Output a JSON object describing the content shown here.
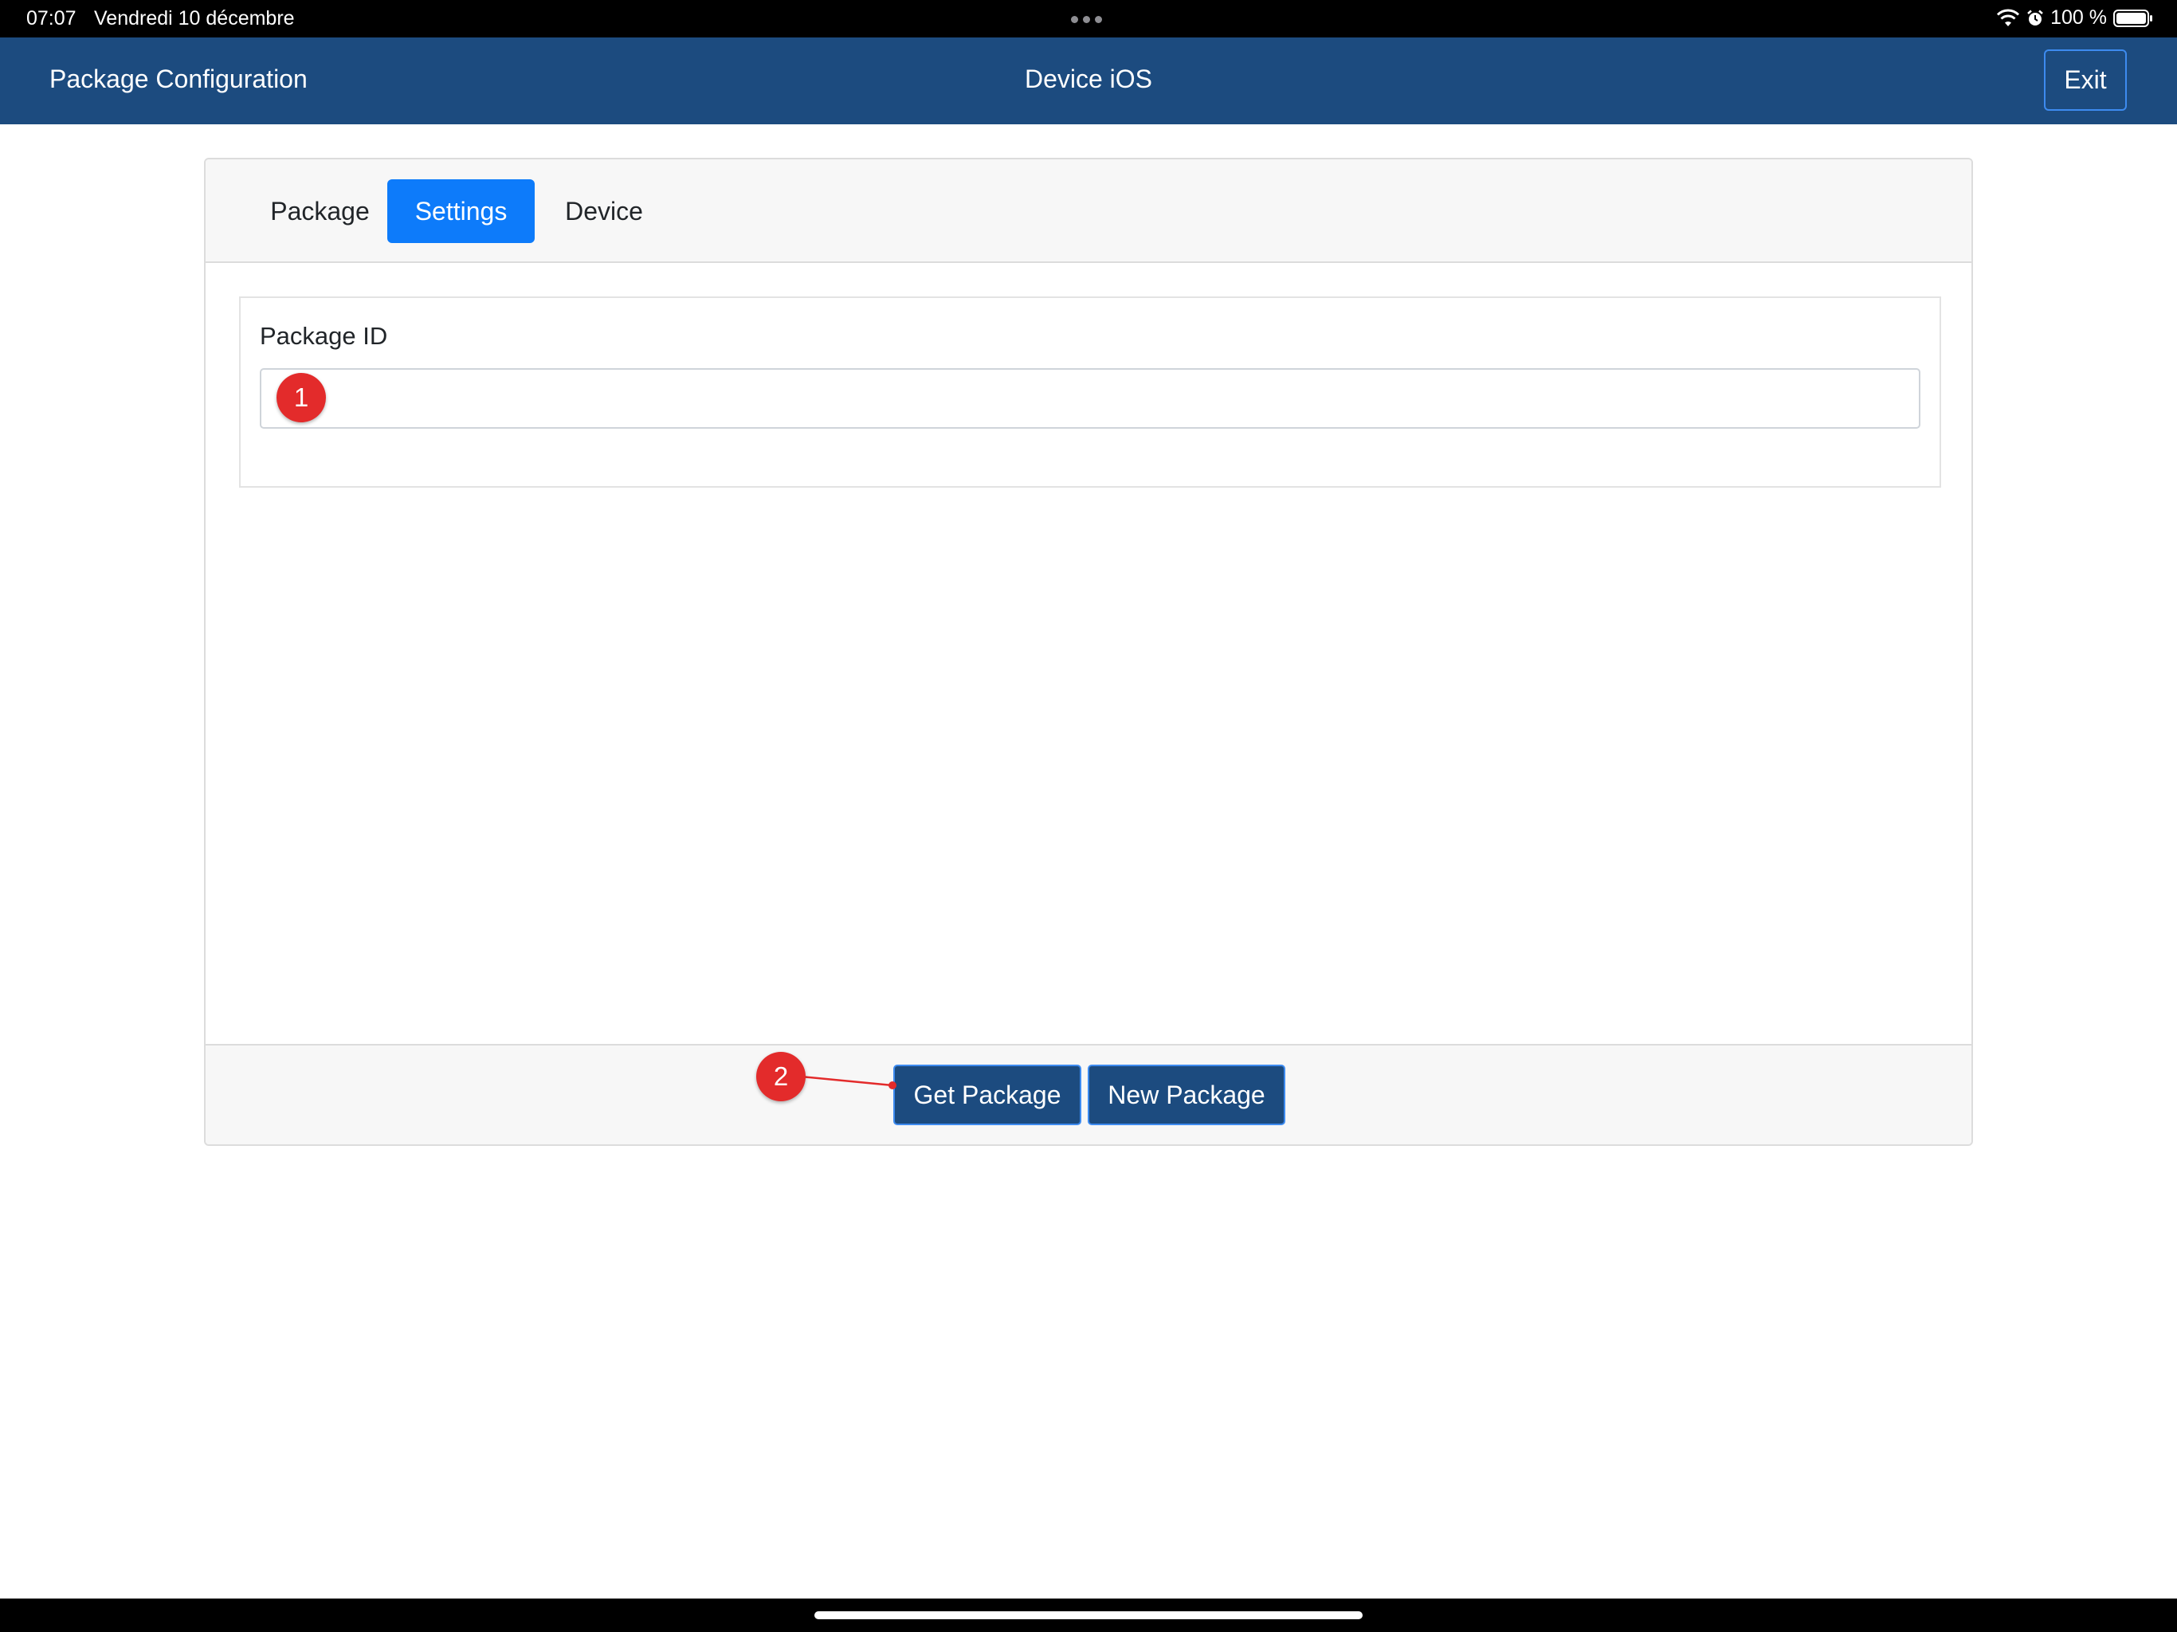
{
  "status_bar": {
    "time": "07:07",
    "date": "Vendredi 10 décembre",
    "battery": "100 %"
  },
  "navbar": {
    "title": "Package Configuration",
    "center": "Device iOS",
    "exit_label": "Exit"
  },
  "tabs": [
    {
      "label": "Package",
      "active": false
    },
    {
      "label": "Settings",
      "active": true
    },
    {
      "label": "Device",
      "active": false
    }
  ],
  "form": {
    "package_id_label": "Package ID",
    "package_id_value": ""
  },
  "footer": {
    "get_label": "Get Package",
    "new_label": "New Package"
  },
  "markers": {
    "one": "1",
    "two": "2"
  },
  "colors": {
    "navbar": "#1c4b7f",
    "active_tab": "#0d7bfa",
    "marker": "#e32b2b"
  }
}
